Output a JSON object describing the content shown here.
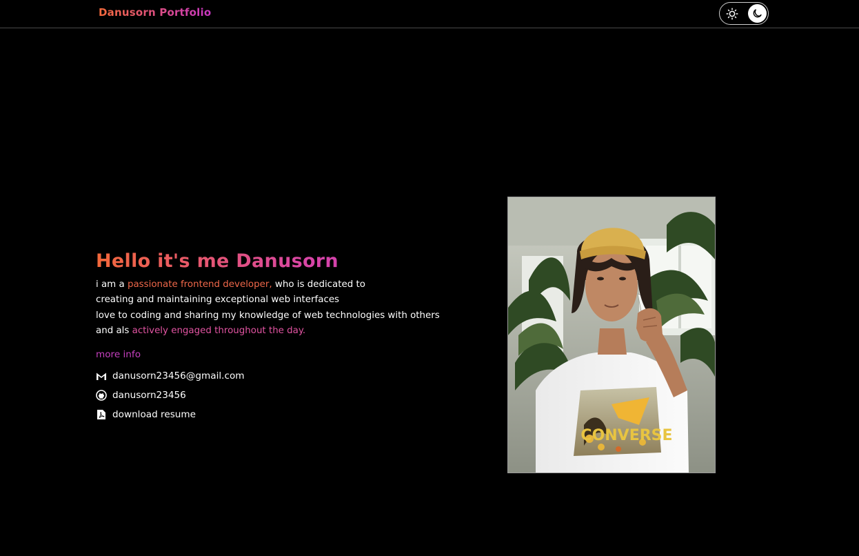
{
  "navbar": {
    "brand": "Danusorn Portfolio",
    "theme_toggle": {
      "light_icon": "sun-icon",
      "dark_icon": "moon-icon",
      "active": "dark"
    }
  },
  "hero": {
    "greeting": "Hello it's me Danusorn",
    "bio": {
      "line1_prefix": "i am a ",
      "line1_highlight": "passionate frontend developer,",
      "line1_suffix": " who is dedicated to",
      "line2": "creating and maintaining exceptional web interfaces",
      "line3": "love to coding and sharing my knowledge of web technologies with others",
      "line4_prefix": "and als ",
      "line4_highlight": "actively engaged throughout the day."
    },
    "more_info_label": "more info",
    "links": [
      {
        "icon": "gmail-icon",
        "label": "danusorn23456@gmail.com"
      },
      {
        "icon": "github-icon",
        "label": "danusorn23456"
      },
      {
        "icon": "pdf-file-icon",
        "label": "download resume"
      }
    ]
  },
  "photo": {
    "shirt_text": "CONVERSE"
  },
  "colors": {
    "background": "#000000",
    "accent_orange": "#f3683a",
    "accent_magenta": "#c334c8"
  }
}
